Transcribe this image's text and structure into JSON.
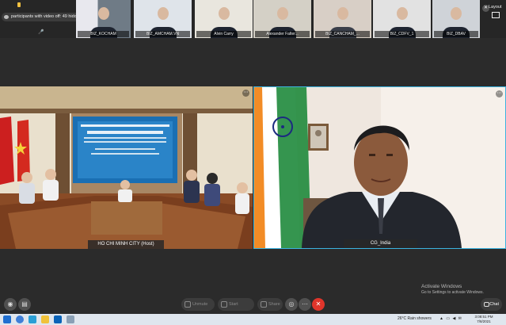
{
  "filmstrip": {
    "hidden_label": "participants with video off: 49 hidden",
    "participants": [
      {
        "name": "BIZ_KOCHAM"
      },
      {
        "name": "BIZ_AMCHAM.VN"
      },
      {
        "name": "Alvin Carry"
      },
      {
        "name": "Alexander Falter..."
      },
      {
        "name": "BIZ_CANCHAM_..."
      },
      {
        "name": "BIZ_CDFV_1"
      },
      {
        "name": "BIZ_DBAV"
      }
    ],
    "layout_label": "Layout"
  },
  "main": {
    "left_tile": {
      "name": "HO CHI MINH CITY (Host)"
    },
    "right_tile": {
      "name": "CG_India"
    }
  },
  "controls": {
    "unmute": "Unmute",
    "start_video": "Start video",
    "share": "Share",
    "chat": "Chat"
  },
  "watermark": {
    "title": "Activate Windows",
    "subtitle": "Go to Settings to activate Windows."
  },
  "taskbar": {
    "weather": "26°C  Rain showers",
    "time": "3:08:51 PM",
    "date": "7/8/2021"
  },
  "colors": {
    "end_call": "#e0352b",
    "active_speaker_border": "#3bb3e0"
  }
}
